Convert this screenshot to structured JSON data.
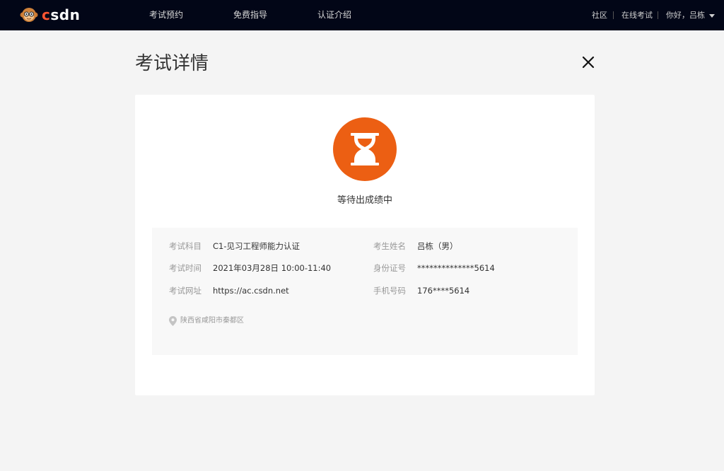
{
  "nav": {
    "logo_text": "csdn",
    "items": [
      {
        "label": "考试预约"
      },
      {
        "label": "免费指导"
      },
      {
        "label": "认证介绍"
      }
    ],
    "right": {
      "community": "社区",
      "online_exam": "在线考试",
      "greeting": "你好，吕栋"
    }
  },
  "page": {
    "title": "考试详情"
  },
  "status": {
    "text": "等待出成绩中",
    "icon": "hourglass-icon",
    "color": "#ec5f13"
  },
  "details": {
    "subject_label": "考试科目",
    "subject_value": "C1-见习工程师能力认证",
    "time_label": "考试时间",
    "time_value": "2021年03月28日 10:00-11:40",
    "url_label": "考试网址",
    "url_value": "https://ac.csdn.net",
    "name_label": "考生姓名",
    "name_value": "吕栋（男）",
    "id_label": "身份证号",
    "id_value": "**************5614",
    "phone_label": "手机号码",
    "phone_value": "176****5614",
    "location": "陕西省咸阳市秦都区"
  }
}
